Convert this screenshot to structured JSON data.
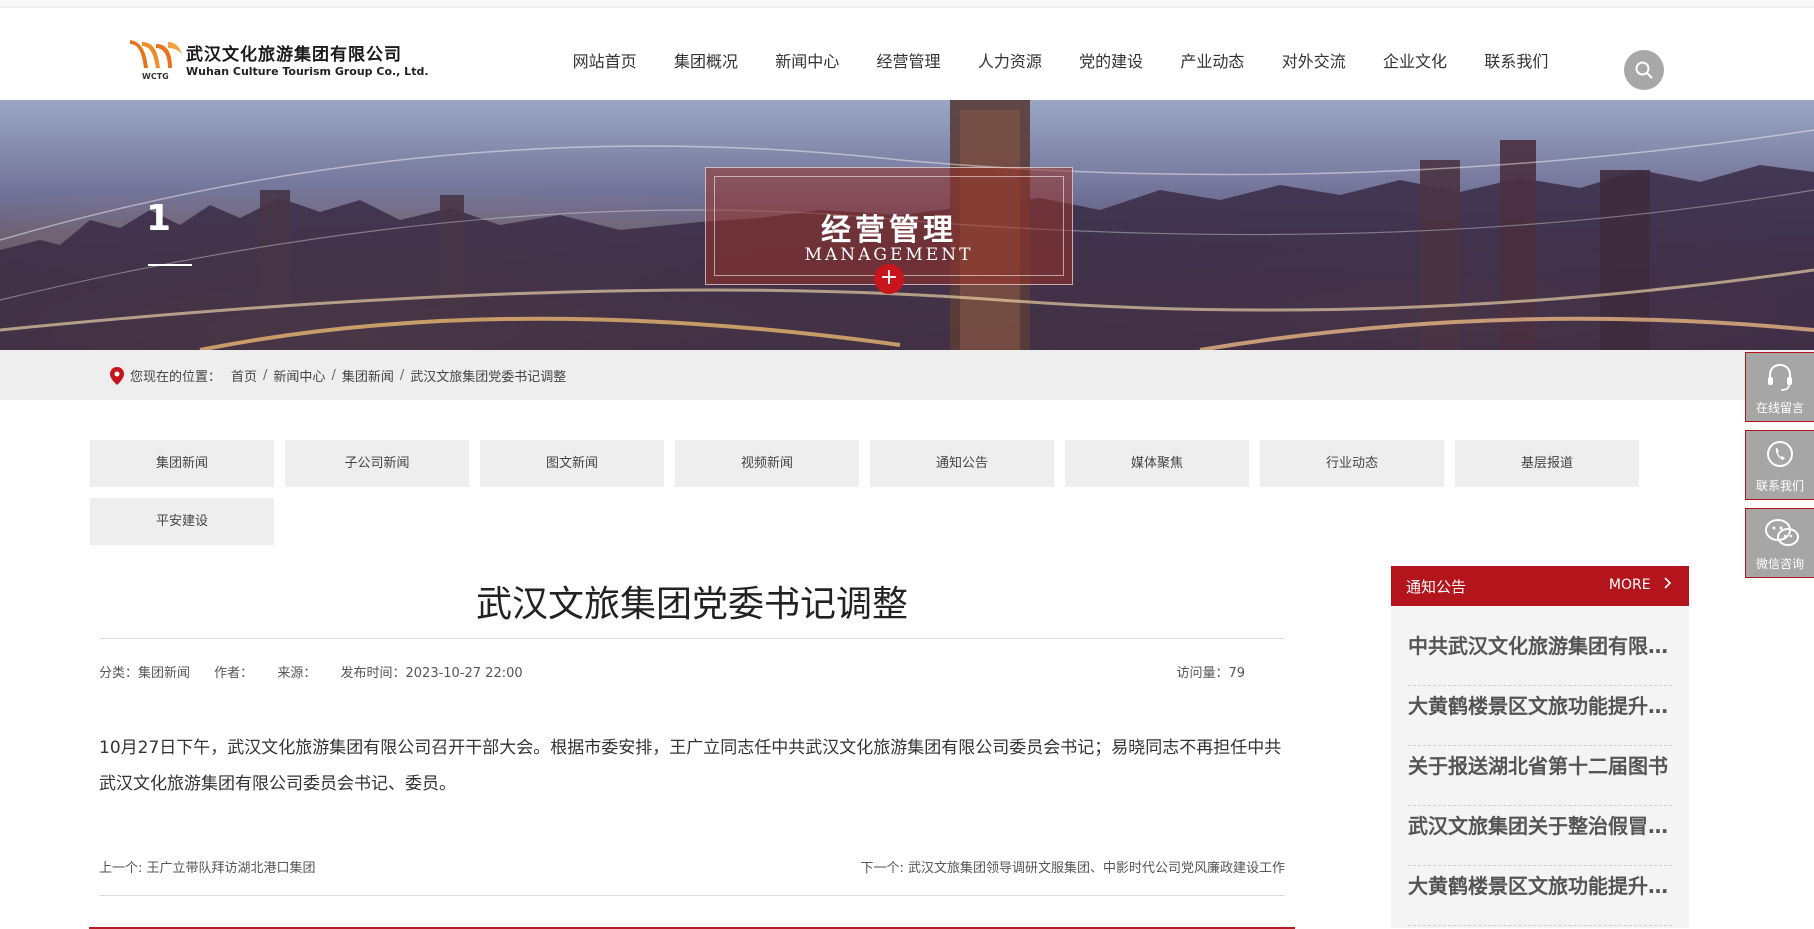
{
  "header": {
    "logo_cn": "武汉文化旅游集团有限公司",
    "logo_en": "Wuhan Culture Tourism Group Co., Ltd.",
    "logo_abbr": "WCTG",
    "nav": [
      "网站首页",
      "集团概况",
      "新闻中心",
      "经营管理",
      "人力资源",
      "党的建设",
      "产业动态",
      "对外交流",
      "企业文化",
      "联系我们"
    ]
  },
  "banner": {
    "slide_number": "1",
    "title_cn": "经营管理",
    "title_en": "MANAGEMENT",
    "plus": "+"
  },
  "breadcrumb": {
    "prefix": "您现在的位置：",
    "items": [
      "首页",
      "新闻中心",
      "集团新闻",
      "武汉文旅集团党委书记调整"
    ],
    "sep": "/"
  },
  "categories": [
    "集团新闻",
    "子公司新闻",
    "图文新闻",
    "视频新闻",
    "通知公告",
    "媒体聚焦",
    "行业动态",
    "基层报道",
    "平安建设"
  ],
  "article": {
    "title": "武汉文旅集团党委书记调整",
    "category_label": "分类：",
    "category": "集团新闻",
    "author_label": "作者：",
    "source_label": "来源：",
    "date_label": "发布时间：",
    "date": "2023-10-27 22:00",
    "views_label": "访问量：",
    "views": "79",
    "body": "10月27日下午，武汉文化旅游集团有限公司召开干部大会。根据市委安排，王广立同志任中共武汉文化旅游集团有限公司委员会书记；易晓同志不再担任中共武汉文化旅游集团有限公司委员会书记、委员。",
    "prev_label": "上一个: ",
    "prev": "王广立带队拜访湖北港口集团",
    "next_label": "下一个: ",
    "next": "武汉文旅集团领导调研文服集团、中影时代公司党风廉政建设工作"
  },
  "sidebar": {
    "title": "通知公告",
    "more": "MORE",
    "items": [
      "中共武汉文化旅游集团有限公司",
      "大黄鹤楼景区文旅功能提升工程",
      "关于报送湖北省第十二届图书",
      "武汉文旅集团关于整治假冒国企",
      "大黄鹤楼景区文旅功能提升工程"
    ]
  },
  "float_tools": [
    "在线留言",
    "联系我们",
    "微信咨询"
  ],
  "colors": {
    "brand_red": "#b4141c",
    "logo_orange": "#e8731c"
  }
}
